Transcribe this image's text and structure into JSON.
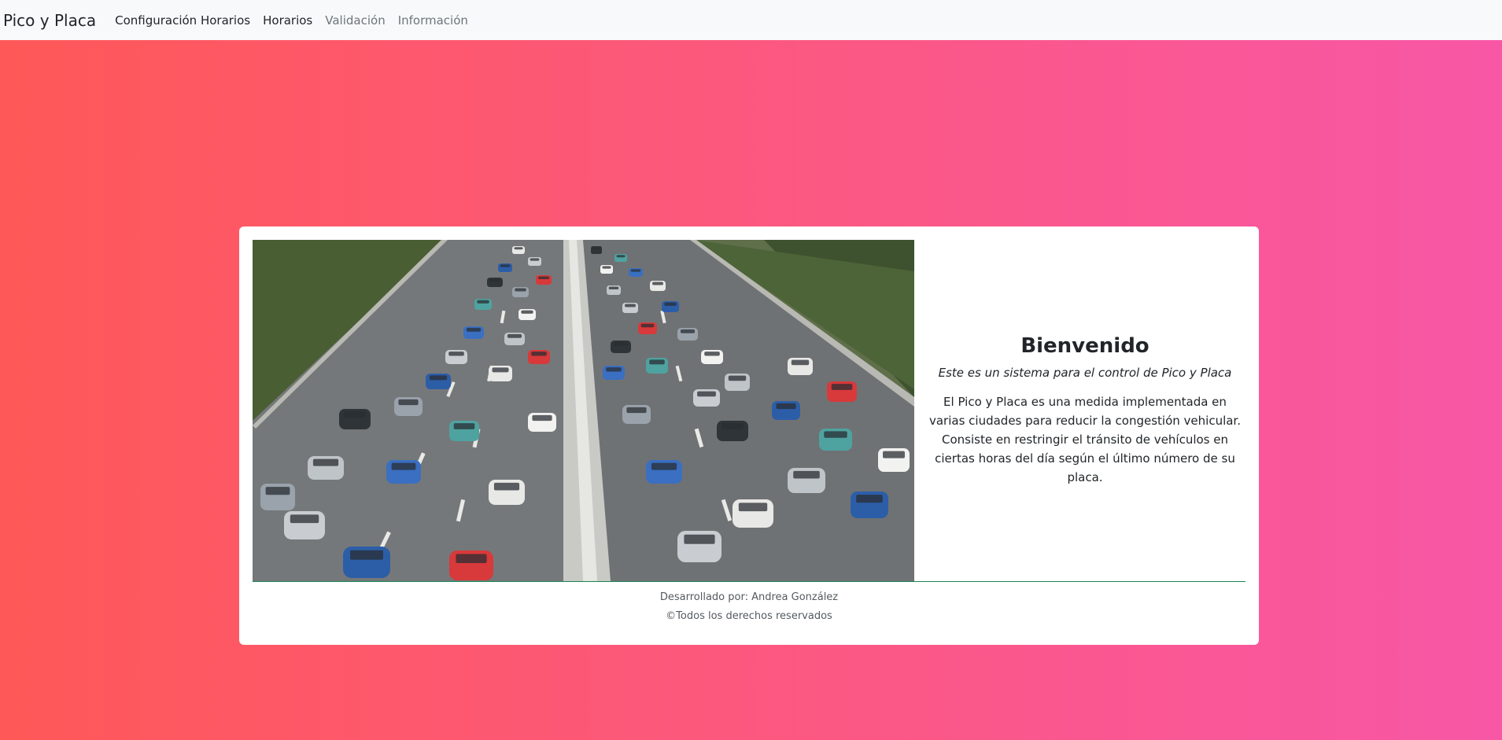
{
  "navbar": {
    "brand": "Pico y Placa",
    "links": [
      {
        "label": "Configuración Horarios"
      },
      {
        "label": "Horarios"
      },
      {
        "label": "Validación"
      },
      {
        "label": "Información"
      }
    ]
  },
  "theme": {
    "gradient_start": "#ff5858",
    "gradient_end": "#f857a6",
    "divider_color": "#198754"
  },
  "welcome": {
    "title": "Bienvenido",
    "subtitle": "Este es un sistema para el control de Pico y Placa",
    "description": "El Pico y Placa es una medida implementada en varias ciudades para reducir la congestión vehicular. Consiste en restringir el tránsito de vehículos en ciertas horas del día según el último número de su placa."
  },
  "footer": {
    "developer": "Desarrollado por: Andrea González",
    "rights": "©Todos los derechos reservados"
  }
}
